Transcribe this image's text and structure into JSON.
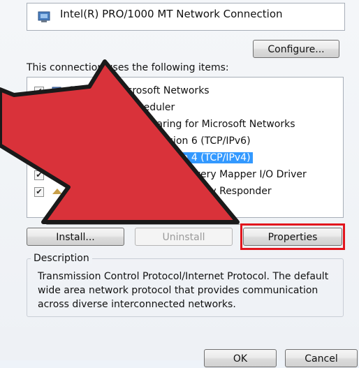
{
  "adapter": {
    "name": "Intel(R) PRO/1000 MT Network Connection",
    "icon": "network-adapter-icon"
  },
  "buttons": {
    "configure": "Configure...",
    "install": "Install...",
    "uninstall": "Uninstall",
    "properties": "Properties",
    "ok": "OK",
    "cancel": "Cancel"
  },
  "items_label": "This connection uses the following items:",
  "items": [
    {
      "label": "Client for Microsoft Networks",
      "checked": true,
      "icon": "network-client-icon"
    },
    {
      "label": "QoS Packet Scheduler",
      "checked": true,
      "icon": "qos-service-icon"
    },
    {
      "label": "File and Printer Sharing for Microsoft Networks",
      "checked": true,
      "icon": "file-sharing-icon"
    },
    {
      "label": "Internet Protocol Version 6 (TCP/IPv6)",
      "checked": true,
      "icon": "protocol-icon"
    },
    {
      "label": "Internet Protocol Version 4 (TCP/IPv4)",
      "checked": true,
      "icon": "protocol-icon",
      "selected": true
    },
    {
      "label": "Link-Layer Topology Discovery Mapper I/O Driver",
      "checked": true,
      "icon": "protocol-icon"
    },
    {
      "label": "Link-Layer Topology Discovery Responder",
      "checked": true,
      "icon": "protocol-icon"
    }
  ],
  "description": {
    "title": "Description",
    "text": "Transmission Control Protocol/Internet Protocol. The default wide area network protocol that provides communication across diverse interconnected networks."
  },
  "colors": {
    "arrow": "#d9323a",
    "highlight": "#e2151d",
    "selection": "#3399ff"
  }
}
